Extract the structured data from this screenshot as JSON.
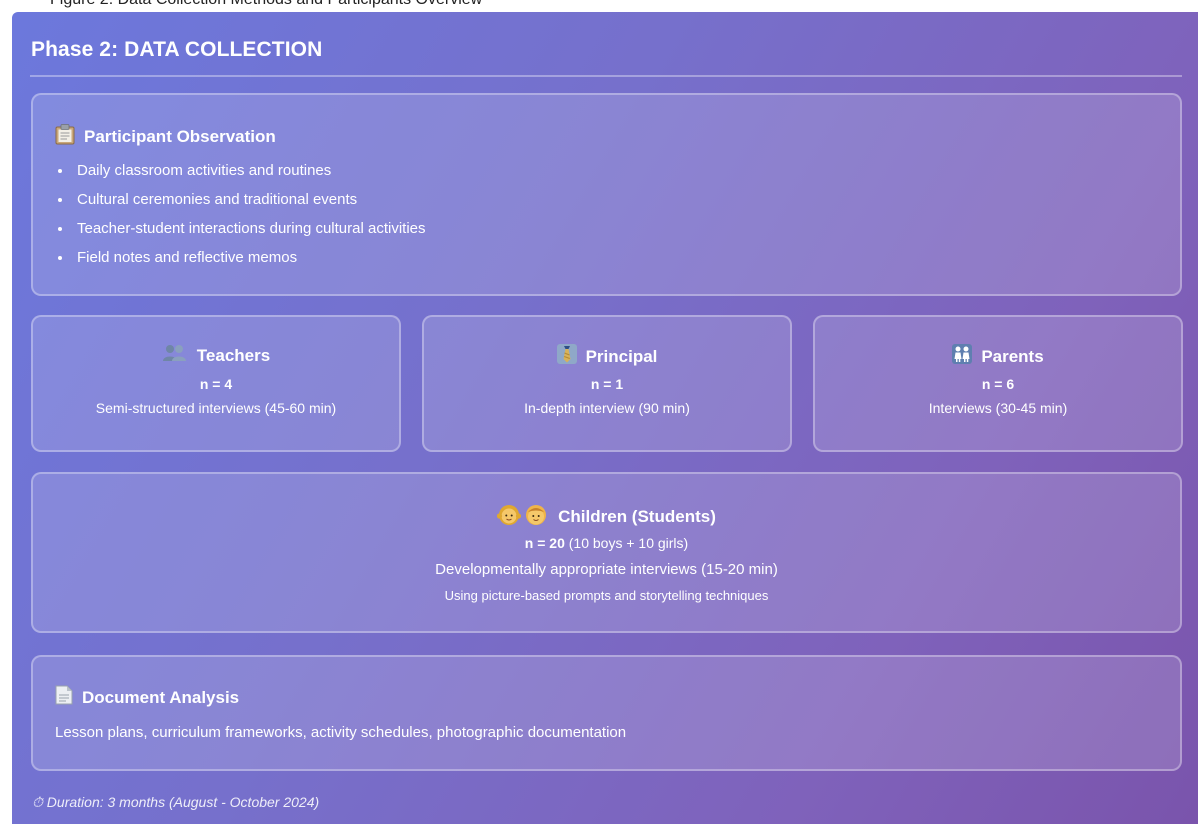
{
  "header_fragment": "Figure 2: Data Collection Methods and Participants Overview",
  "phase_title": "Phase 2: DATA COLLECTION",
  "observation": {
    "title": "Participant Observation",
    "items": [
      "Daily classroom activities and routines",
      "Cultural ceremonies and traditional events",
      "Teacher-student interactions during cultural activities",
      "Field notes and reflective memos"
    ]
  },
  "teachers": {
    "title": "Teachers",
    "n": "n = 4",
    "desc": "Semi-structured interviews (45-60 min)"
  },
  "principal": {
    "title": "Principal",
    "n": "n = 1",
    "desc": "In-depth interview (90 min)"
  },
  "parents": {
    "title": "Parents",
    "n": "n = 6",
    "desc": "Interviews (30-45 min)"
  },
  "children": {
    "title": "Children (Students)",
    "n_bold": "n = 20",
    "n_rest": " (10 boys + 10 girls)",
    "desc": "Developmentally appropriate interviews (15-20 min)",
    "sub": "Using picture-based prompts and storytelling techniques"
  },
  "document": {
    "title": "Document Analysis",
    "text": "Lesson plans, curriculum frameworks, activity schedules, photographic documentation"
  },
  "duration": "⏱ Duration: 3 months (August - October 2024)",
  "colors": {
    "panel_start": "#6c78dc",
    "panel_end": "#7a54ac",
    "text": "#ffffff"
  },
  "icons": {
    "observation": "clipboard-icon",
    "teachers": "people-icon",
    "principal": "necktie-icon",
    "parents": "family-icon",
    "children": "children-icon",
    "document": "document-icon"
  }
}
